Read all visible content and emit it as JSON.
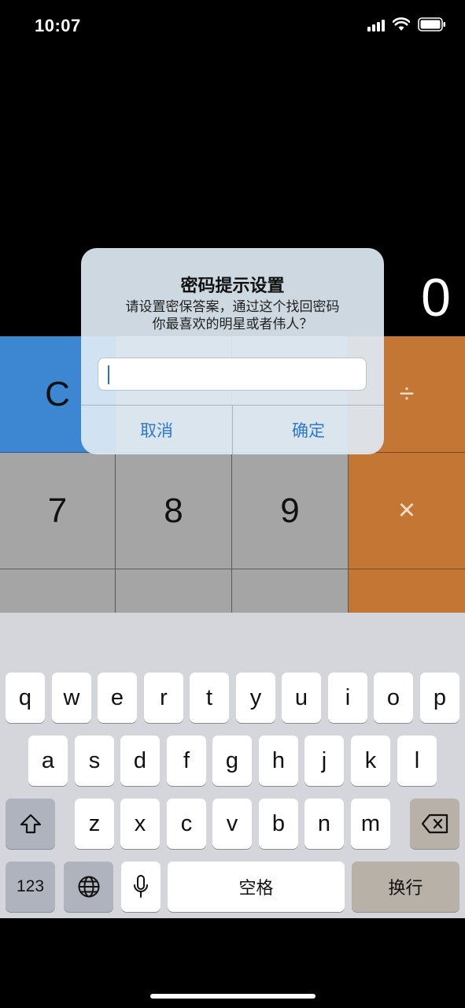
{
  "status_bar": {
    "time": "10:07",
    "signal_icon": "cellular-signal-icon",
    "wifi_icon": "wifi-icon",
    "battery_icon": "battery-icon"
  },
  "calculator": {
    "display_value": "0",
    "keys": {
      "clear": "C",
      "divide": "÷",
      "seven": "7",
      "eight": "8",
      "nine": "9",
      "multiply": "×"
    },
    "colors": {
      "grey": "#a5a5a5",
      "orange": "#c47634",
      "blue": "#3c86d2"
    }
  },
  "alert": {
    "title": "密码提示设置",
    "message_line1": "请设置密保答案，通过这个找回密码",
    "message_line2": "你最喜欢的明星或者伟人？",
    "input_value": "",
    "cancel_label": "取消",
    "confirm_label": "确定",
    "accent_color": "#2e78c8"
  },
  "keyboard": {
    "row1": [
      "q",
      "w",
      "e",
      "r",
      "t",
      "y",
      "u",
      "i",
      "o",
      "p"
    ],
    "row2": [
      "a",
      "s",
      "d",
      "f",
      "g",
      "h",
      "j",
      "k",
      "l"
    ],
    "row3": [
      "z",
      "x",
      "c",
      "v",
      "b",
      "n",
      "m"
    ],
    "shift_icon": "shift-icon",
    "backspace_icon": "backspace-icon",
    "numbers_label": "123",
    "globe_icon": "globe-icon",
    "mic_icon": "microphone-icon",
    "space_label": "空格",
    "return_label": "换行"
  }
}
